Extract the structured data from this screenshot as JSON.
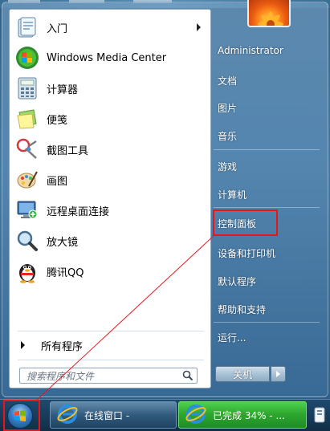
{
  "start_menu": {
    "programs": [
      {
        "label": "入门",
        "icon": "getting-started-icon",
        "has_submenu": true
      },
      {
        "label": "Windows Media Center",
        "icon": "windows-media-center-icon",
        "has_submenu": false
      },
      {
        "label": "计算器",
        "icon": "calculator-icon",
        "has_submenu": false
      },
      {
        "label": "便笺",
        "icon": "sticky-notes-icon",
        "has_submenu": false
      },
      {
        "label": "截图工具",
        "icon": "snipping-tool-icon",
        "has_submenu": false
      },
      {
        "label": "画图",
        "icon": "paint-icon",
        "has_submenu": false
      },
      {
        "label": "远程桌面连接",
        "icon": "remote-desktop-icon",
        "has_submenu": false
      },
      {
        "label": "放大镜",
        "icon": "magnifier-icon",
        "has_submenu": false
      },
      {
        "label": "腾讯QQ",
        "icon": "qq-penguin-icon",
        "has_submenu": false
      }
    ],
    "all_programs": "所有程序",
    "search_placeholder": "搜索程序和文件"
  },
  "right_pane": {
    "links": [
      {
        "label": "Administrator"
      },
      {
        "label": "文档"
      },
      {
        "label": "图片"
      },
      {
        "label": "音乐"
      },
      {
        "label": "游戏"
      },
      {
        "label": "计算机"
      },
      {
        "label": "控制面板",
        "highlighted": true
      },
      {
        "label": "设备和打印机"
      },
      {
        "label": "默认程序"
      },
      {
        "label": "帮助和支持"
      },
      {
        "label": "运行..."
      }
    ],
    "shutdown_label": "关机"
  },
  "taskbar": {
    "buttons": [
      {
        "label": "在线窗口 -"
      },
      {
        "label": "已完成 34% - ..."
      }
    ]
  },
  "colors": {
    "annotation_red": "#e8161a",
    "taskbar_progress_green": "#2fa82f"
  }
}
